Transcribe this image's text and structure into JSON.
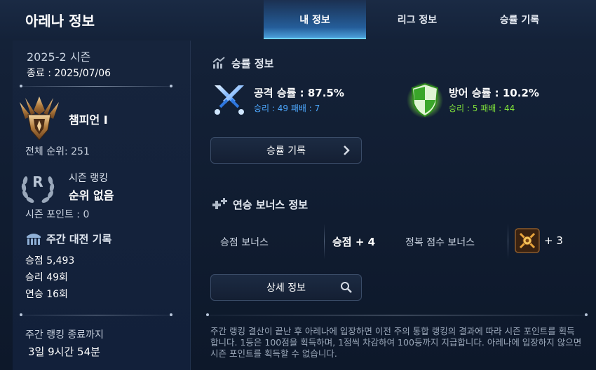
{
  "header": {
    "title": "아레나 정보",
    "tabs": [
      {
        "label": "내 정보",
        "active": true
      },
      {
        "label": "리그 정보",
        "active": false
      },
      {
        "label": "승률 기록",
        "active": false
      }
    ]
  },
  "left": {
    "season": "2025-2 시즌",
    "end_date": "종료 : 2025/07/06",
    "rank_name": "챔피언 I",
    "overall_rank": "전체 순위: 251",
    "season_ranking_label": "시즌 랭킹",
    "season_ranking_value": "순위 없음",
    "season_ranking_letter": "R",
    "season_points": "시즌 포인트 : 0",
    "weekly_title": "주간 대전 기록",
    "weekly_stats": [
      "승점 5,493",
      "승리 49회",
      "연승 16회"
    ],
    "until_label": "주간 랭킹 종료까지",
    "until_value": "3일 9시간 54분"
  },
  "winrate": {
    "section_title": "승률 정보",
    "attack": {
      "title": "공격 승률 : 87.5%",
      "sub": "승리 : 49 패배 : 7",
      "color": "#4da8ff"
    },
    "defense": {
      "title": "방어 승률 : 10.2%",
      "sub": "승리 : 5 패배 : 44",
      "color": "#7ee03a"
    },
    "record_button": "승률 기록"
  },
  "bonus": {
    "section_title": "연승 보너스 정보",
    "points_label": "승점 보너스",
    "points_value": "승점 + 4",
    "conquest_label": "정복 점수 보너스",
    "conquest_value": "+ 3",
    "details_button": "상세 정보"
  },
  "notice": "주간 랭킹 결산이 끝난 후 아레나에 입장하면 이전 주의 통합 랭킹의 결과에 따라 시즌 포인트를 획득합니다. 1등은 100점을 획득하며, 1점씩 차감하여 100등까지 지급합니다. 아레나에 입장하지 않으면 시즌 포인트를 획득할 수 없습니다."
}
